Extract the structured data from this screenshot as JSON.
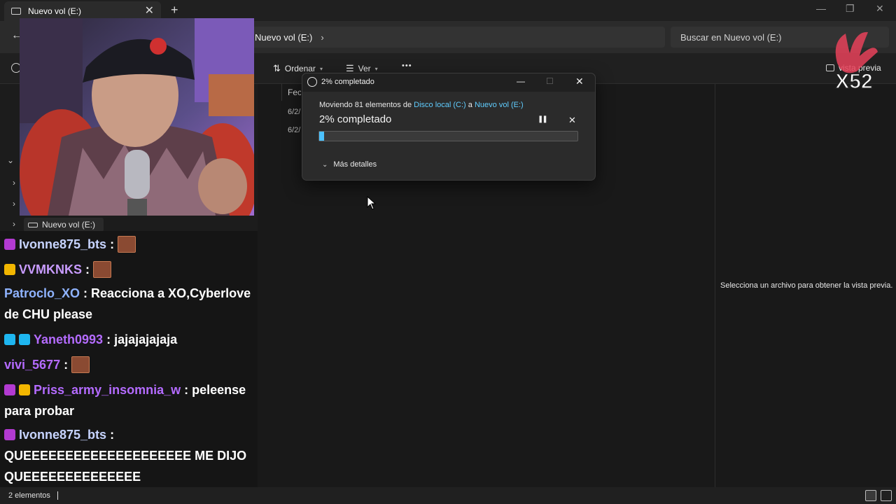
{
  "window": {
    "tab_title": "Nuevo vol (E:)",
    "tab_close": "✕",
    "new_tab": "+",
    "minimize": "—",
    "maximize": "❐",
    "close": "✕"
  },
  "address": {
    "path": "Nuevo vol (E:)",
    "chevron": "›",
    "search_placeholder": "Buscar en Nuevo vol (E:)",
    "back": "←"
  },
  "commands": {
    "sort": "Ordenar",
    "view": "Ver",
    "more": "•••",
    "preview_partial": "vista previa"
  },
  "content": {
    "column_header": "Fecha",
    "rows": [
      {
        "date": "6/2/"
      },
      {
        "date": "6/2/"
      }
    ],
    "preview_message": "Selecciona un archivo para obtener la vista previa."
  },
  "nav": {
    "drive_label": "Nuevo vol (E:)"
  },
  "status": {
    "count": "2 elementos"
  },
  "dialog": {
    "title": "2% completado",
    "subtitle_prefix": "Moviendo 81 elementos de ",
    "source": "Disco local (C:)",
    "subtitle_mid": " a ",
    "destination": "Nuevo vol (E:)",
    "percent_label": "2% completado",
    "progress": 0.02,
    "details_label": "Más detalles",
    "minimize": "—",
    "maximize": "☐",
    "close": "✕",
    "pause": "❚❚",
    "cancel": "✕"
  },
  "overlay": {
    "logo_text": "X52"
  },
  "chat": [
    {
      "user": "Ivonne875_bts",
      "color": "#c7d4ff",
      "badges": [
        "#b23ad1"
      ],
      "text": "",
      "emote": true
    },
    {
      "user": "VVMKNKS",
      "color": "#c99cff",
      "badges": [
        "#f2b600"
      ],
      "text": "",
      "emote": true
    },
    {
      "user": "Patroclo_XO",
      "color": "#8fb3ff",
      "badges": [],
      "text": "Reacciona a XO,Cyberlove de CHU please",
      "emote": false
    },
    {
      "user": "Yaneth0993",
      "color": "#b46bff",
      "badges": [
        "#1eb6f0",
        "#1eb6f0"
      ],
      "text": "jajajajajaja",
      "emote": false
    },
    {
      "user": "vivi_5677",
      "color": "#b46bff",
      "badges": [],
      "text": "",
      "emote": true
    },
    {
      "user": "Priss_army_insomnia_w",
      "color": "#b46bff",
      "badges": [
        "#b23ad1",
        "#f2b600"
      ],
      "text": "peleense para probar",
      "emote": false
    },
    {
      "user": "Ivonne875_bts",
      "color": "#c7d4ff",
      "badges": [
        "#b23ad1"
      ],
      "text": "QUEEEEEEEEEEEEEEEEEEEE ME DIJO QUEEEEEEEEEEEEEE",
      "emote": false
    }
  ]
}
